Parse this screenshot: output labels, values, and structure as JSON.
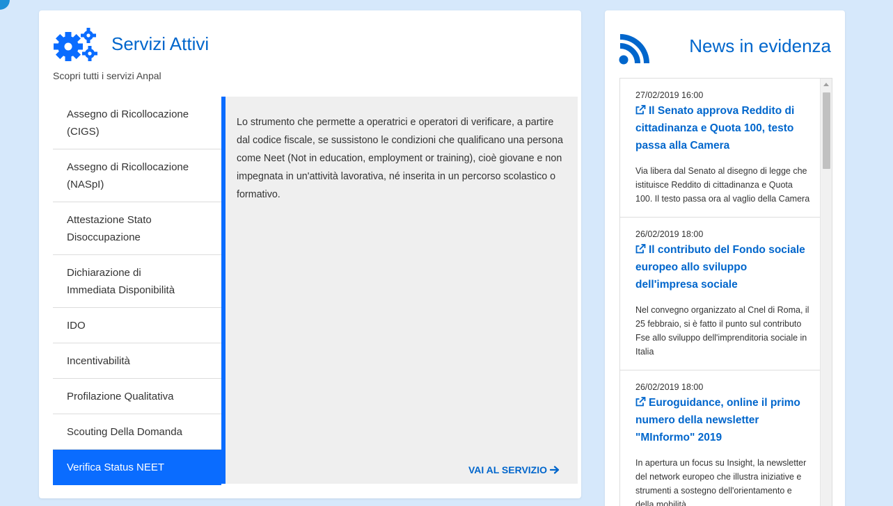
{
  "servizi": {
    "title": "Servizi Attivi",
    "icon": "gears-icon",
    "subtitle": "Scopri tutti i servizi Anpal",
    "items": [
      {
        "line1": "Assegno di Ricollocazione",
        "line2": "(CIGS)"
      },
      {
        "line1": "Assegno di Ricollocazione",
        "line2": "(NASpI)"
      },
      {
        "line1": "Attestazione Stato",
        "line2": "Disoccupazione"
      },
      {
        "line1": "Dichiarazione di",
        "line2": "Immediata Disponibilità"
      },
      {
        "line1": "IDO"
      },
      {
        "line1": "Incentivabilità"
      },
      {
        "line1": "Profilazione Qualitativa"
      },
      {
        "line1": "Scouting Della Domanda"
      },
      {
        "line1": "Verifica Status NEET",
        "active": true
      }
    ],
    "detail": {
      "description": "Lo strumento che permette a operatrici e operatori di verificare, a partire dal codice fiscale, se sussistono le condizioni che qualificano una persona come Neet (Not in education, employment or training), cioè giovane e non impegnata in un'attività lavorativa, né inserita in un percorso scolastico o formativo.",
      "link_label": "VAI AL SERVIZIO",
      "link_icon": "arrow-right-icon"
    }
  },
  "news": {
    "title": "News in evidenza",
    "icon": "rss-icon",
    "items": [
      {
        "date": "27/02/2019 16:00",
        "headline": "Il Senato approva Reddito di cittadinanza e Quota 100, testo passa alla Camera",
        "description": "Via libera dal Senato al disegno di legge che istituisce Reddito di cittadinanza e Quota 100. Il testo passa ora al vaglio della Camera"
      },
      {
        "date": "26/02/2019 18:00",
        "headline": "Il contributo del Fondo sociale europeo allo sviluppo dell'impresa sociale",
        "description": "Nel convegno organizzato al Cnel di Roma, il 25 febbraio, si è fatto il punto sul contributo Fse allo sviluppo dell'imprenditoria sociale in Italia"
      },
      {
        "date": "26/02/2019 18:00",
        "headline": "Euroguidance, online il primo numero della newsletter \"MInformo\" 2019",
        "description": "In apertura un focus su Insight, la newsletter del network europeo che illustra iniziative e strumenti a sostegno dell'orientamento e della mobilità"
      }
    ]
  },
  "colors": {
    "accent": "#0a6cff",
    "link": "#0066cc",
    "background": "#d6e8fb",
    "panel": "#efefef"
  }
}
